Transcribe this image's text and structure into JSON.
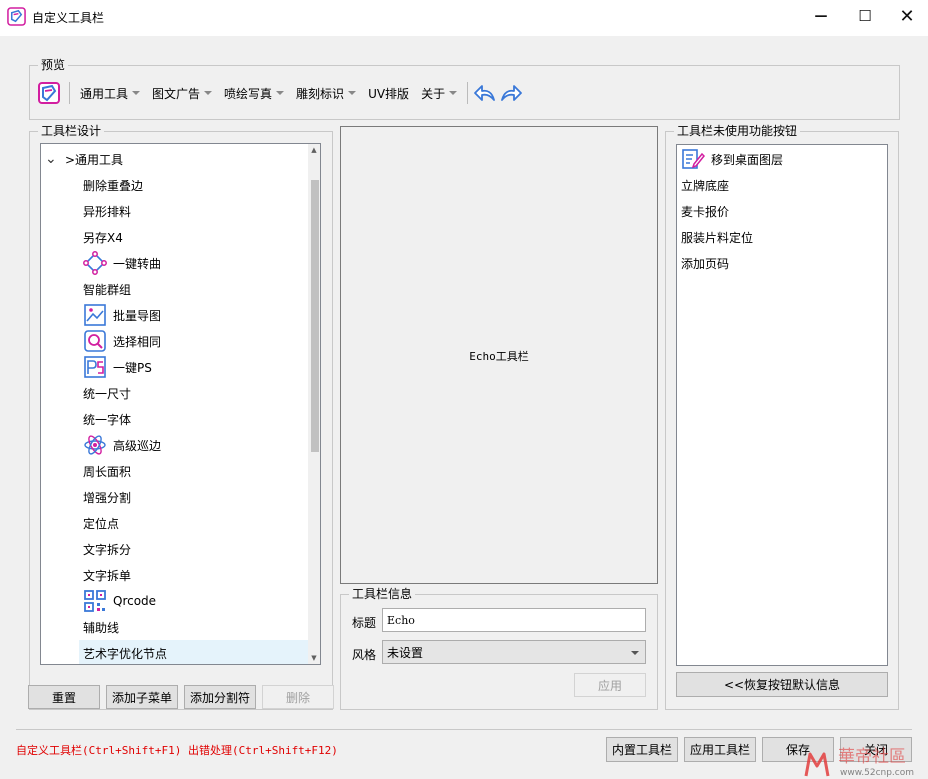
{
  "window": {
    "title": "自定义工具栏",
    "minimize": "—",
    "maximize": "☐",
    "close": "✕"
  },
  "preview": {
    "group_label": "预览",
    "menus": [
      "通用工具",
      "图文广告",
      "喷绘写真",
      "雕刻标识",
      "UV排版",
      "关于"
    ],
    "has_dropdown": [
      true,
      true,
      true,
      true,
      false,
      true
    ]
  },
  "designer": {
    "group_label": "工具栏设计",
    "root": {
      "expander": "⌄",
      "label": ">通用工具"
    },
    "items": [
      {
        "label": "删除重叠边",
        "icon": ""
      },
      {
        "label": "异形排料",
        "icon": ""
      },
      {
        "label": "另存X4",
        "icon": ""
      },
      {
        "label": "一键转曲",
        "icon": "curve-nodes-icon"
      },
      {
        "label": "智能群组",
        "icon": ""
      },
      {
        "label": "批量导图",
        "icon": "image-export-icon"
      },
      {
        "label": "选择相同",
        "icon": "select-same-icon"
      },
      {
        "label": "一键PS",
        "icon": "ps-icon"
      },
      {
        "label": "统一尺寸",
        "icon": ""
      },
      {
        "label": "统一字体",
        "icon": ""
      },
      {
        "label": "高级巡边",
        "icon": "atom-icon"
      },
      {
        "label": "周长面积",
        "icon": ""
      },
      {
        "label": "增强分割",
        "icon": ""
      },
      {
        "label": "定位点",
        "icon": ""
      },
      {
        "label": "文字拆分",
        "icon": ""
      },
      {
        "label": "文字拆单",
        "icon": ""
      },
      {
        "label": "Qrcode",
        "icon": "qrcode-icon"
      },
      {
        "label": "辅助线",
        "icon": ""
      },
      {
        "label": "艺术字优化节点",
        "icon": "",
        "selected": true
      }
    ],
    "buttons": {
      "reset": "重置",
      "add_submenu": "添加子菜单",
      "add_separator": "添加分割符",
      "delete": "删除"
    }
  },
  "canvas": {
    "label": "Echo工具栏"
  },
  "info": {
    "group_label": "工具栏信息",
    "title_label": "标题",
    "title_value": "Echo",
    "style_label": "风格",
    "style_value": "未设置",
    "apply": "应用"
  },
  "unused": {
    "group_label": "工具栏未使用功能按钮",
    "items": [
      {
        "label": "移到桌面图层",
        "icon": "edit-document-icon"
      },
      {
        "label": "立牌底座",
        "icon": ""
      },
      {
        "label": "麦卡报价",
        "icon": ""
      },
      {
        "label": "服装片料定位",
        "icon": ""
      },
      {
        "label": "添加页码",
        "icon": ""
      }
    ],
    "restore_button": "<<恢复按钮默认信息"
  },
  "footer": {
    "status": "自定义工具栏(Ctrl+Shift+F1)  出错处理(Ctrl+Shift+F12)",
    "builtin": "内置工具栏",
    "apply_toolbar": "应用工具栏",
    "save": "保存",
    "close": "关闭"
  },
  "watermark": {
    "text": "華帝社區",
    "url": "www.52cnp.com"
  },
  "colors": {
    "accent": "#3a78d8",
    "selected_row": "#e5f3fb",
    "status_red": "#e00000",
    "logo_magenta": "#d21ea0"
  }
}
